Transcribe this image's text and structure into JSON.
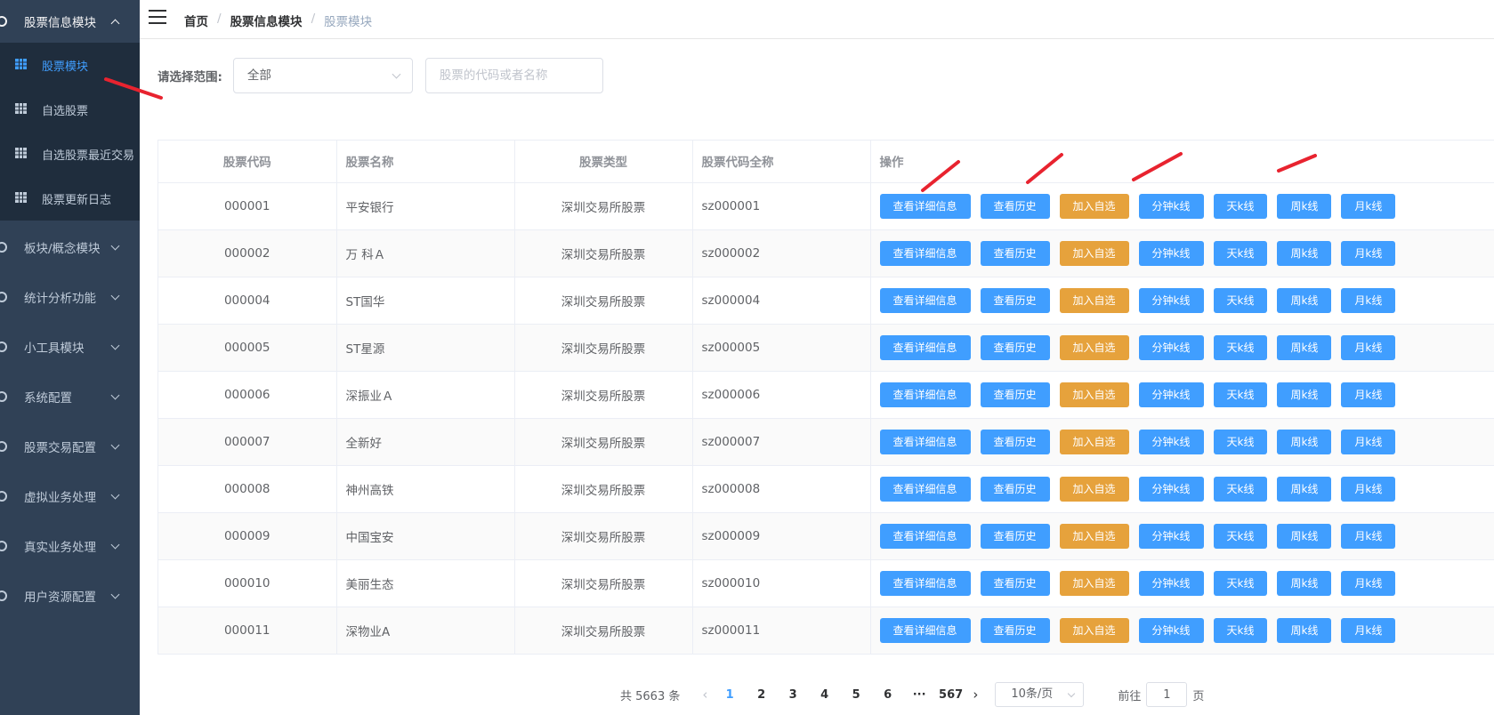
{
  "sidebar": {
    "open_group": "股票信息模块",
    "sub_items": [
      {
        "label": "股票模块",
        "active": true
      },
      {
        "label": "自选股票",
        "active": false
      },
      {
        "label": "自选股票最近交易",
        "active": false
      },
      {
        "label": "股票更新日志",
        "active": false
      }
    ],
    "groups": [
      "板块/概念模块",
      "统计分析功能",
      "小工具模块",
      "系统配置",
      "股票交易配置",
      "虚拟业务处理",
      "真实业务处理",
      "用户资源配置"
    ]
  },
  "header": {
    "breadcrumb": [
      "首页",
      "股票信息模块",
      "股票模块"
    ]
  },
  "filter": {
    "label": "请选择范围:",
    "range_value": "全部",
    "search_placeholder": "股票的代码或者名称"
  },
  "table": {
    "columns": [
      "股票代码",
      "股票名称",
      "股票类型",
      "股票代码全称",
      "操作"
    ],
    "actions": [
      "查看详细信息",
      "查看历史",
      "加入自选",
      "分钟k线",
      "天k线",
      "周k线",
      "月k线"
    ],
    "rows": [
      {
        "code": "000001",
        "name": "平安银行",
        "type": "深圳交易所股票",
        "full": "sz000001"
      },
      {
        "code": "000002",
        "name": "万 科Ａ",
        "type": "深圳交易所股票",
        "full": "sz000002"
      },
      {
        "code": "000004",
        "name": "ST国华",
        "type": "深圳交易所股票",
        "full": "sz000004"
      },
      {
        "code": "000005",
        "name": "ST星源",
        "type": "深圳交易所股票",
        "full": "sz000005"
      },
      {
        "code": "000006",
        "name": "深振业Ａ",
        "type": "深圳交易所股票",
        "full": "sz000006"
      },
      {
        "code": "000007",
        "name": "全新好",
        "type": "深圳交易所股票",
        "full": "sz000007"
      },
      {
        "code": "000008",
        "name": "神州高铁",
        "type": "深圳交易所股票",
        "full": "sz000008"
      },
      {
        "code": "000009",
        "name": "中国宝安",
        "type": "深圳交易所股票",
        "full": "sz000009"
      },
      {
        "code": "000010",
        "name": "美丽生态",
        "type": "深圳交易所股票",
        "full": "sz000010"
      },
      {
        "code": "000011",
        "name": "深物业A",
        "type": "深圳交易所股票",
        "full": "sz000011"
      }
    ]
  },
  "pagination": {
    "total": "共 5663 条",
    "pages": [
      "1",
      "2",
      "3",
      "4",
      "5",
      "6"
    ],
    "current": "1",
    "ellipsis": "···",
    "last_page": "567",
    "page_size": "10条/页",
    "goto_label": "前往",
    "goto_value": "1",
    "goto_suffix": "页"
  },
  "colors": {
    "sidebar_bg": "#304156",
    "submenu_bg": "#1f2d3d",
    "primary": "#409eff",
    "warning": "#e6a23c",
    "annotation": "#e8232f"
  }
}
